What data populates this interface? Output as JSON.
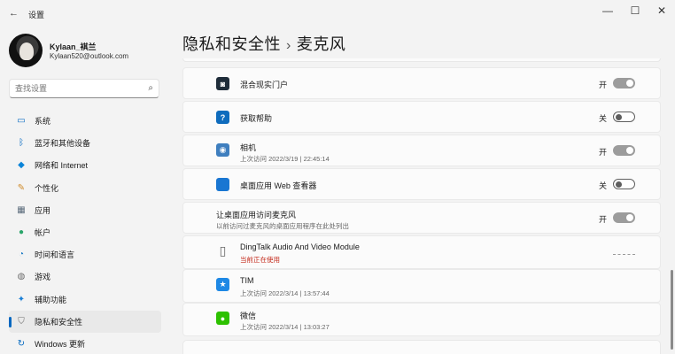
{
  "window": {
    "title": "设置",
    "back": "←",
    "minimize": "—",
    "maximize": "☐",
    "close": "✕"
  },
  "profile": {
    "name": "Kylaan_褀兰",
    "email": "Kylaan520@outlook.com"
  },
  "search": {
    "placeholder": "查找设置",
    "icon": "⌕"
  },
  "sidebar": {
    "items": [
      {
        "label": "系统",
        "icon": "monitor-icon",
        "glyph": "▭",
        "color": "#0067c0"
      },
      {
        "label": "蓝牙和其他设备",
        "icon": "bluetooth-icon",
        "glyph": "ᛒ",
        "color": "#0067c0"
      },
      {
        "label": "网络和 Internet",
        "icon": "wifi-icon",
        "glyph": "◆",
        "color": "#0a84d8"
      },
      {
        "label": "个性化",
        "icon": "brush-icon",
        "glyph": "✎",
        "color": "#d08b2a"
      },
      {
        "label": "应用",
        "icon": "apps-icon",
        "glyph": "▦",
        "color": "#5a6b7b"
      },
      {
        "label": "帐户",
        "icon": "person-icon",
        "glyph": "●",
        "color": "#2aa56a"
      },
      {
        "label": "时间和语言",
        "icon": "globe-clock-icon",
        "glyph": "◔",
        "color": "#1e7bc4"
      },
      {
        "label": "游戏",
        "icon": "gamepad-icon",
        "glyph": "◍",
        "color": "#6b6b6b"
      },
      {
        "label": "辅助功能",
        "icon": "accessibility-icon",
        "glyph": "✦",
        "color": "#1a7fd6"
      },
      {
        "label": "隐私和安全性",
        "icon": "shield-icon",
        "glyph": "⛉",
        "color": "#6b6b6b",
        "active": true
      },
      {
        "label": "Windows 更新",
        "icon": "update-icon",
        "glyph": "↻",
        "color": "#0067c0"
      }
    ]
  },
  "header": {
    "parent": "隐私和安全性",
    "separator": "›",
    "current": "麦克风"
  },
  "rows": [
    {
      "name": "混合现实门户",
      "sub": "",
      "state": "开",
      "toggle": "on",
      "icon": "mixed-reality-icon",
      "glyph": "◙",
      "bg": "#1f2d3a"
    },
    {
      "name": "获取帮助",
      "sub": "",
      "state": "关",
      "toggle": "off",
      "icon": "help-icon",
      "glyph": "?",
      "bg": "#0f6cbd"
    },
    {
      "name": "相机",
      "sub": "上次访问 2022/3/19 | 22:45:14",
      "state": "开",
      "toggle": "on",
      "icon": "camera-icon",
      "glyph": "◉",
      "bg": "#3f7fbf"
    },
    {
      "name": "桌面应用 Web 查看器",
      "sub": "",
      "state": "关",
      "toggle": "off",
      "icon": "web-viewer-icon",
      "glyph": "",
      "bg": "#1976d2"
    },
    {
      "name": "让桌面应用访问麦克风",
      "sub": "以前访问过麦克风的桌面应用程序在此处列出",
      "state": "开",
      "toggle": "on",
      "icon": "",
      "glyph": "",
      "bg": ""
    },
    {
      "name": "DingTalk Audio And Video Module",
      "sub": "当前正在使用",
      "state": "",
      "toggle": "none",
      "icon": "file-icon",
      "glyph": "▯",
      "bg": "transparent",
      "sub_red": true
    },
    {
      "name": "TIM",
      "sub": "上次访问 2022/3/14 | 13:57:44",
      "state": "",
      "toggle": "none",
      "icon": "tim-icon",
      "glyph": "★",
      "bg": "#1e88e5"
    },
    {
      "name": "微信",
      "sub": "上次访问 2022/3/14 | 13:03:27",
      "state": "",
      "toggle": "none",
      "icon": "wechat-icon",
      "glyph": "●",
      "bg": "#2dc100"
    }
  ]
}
